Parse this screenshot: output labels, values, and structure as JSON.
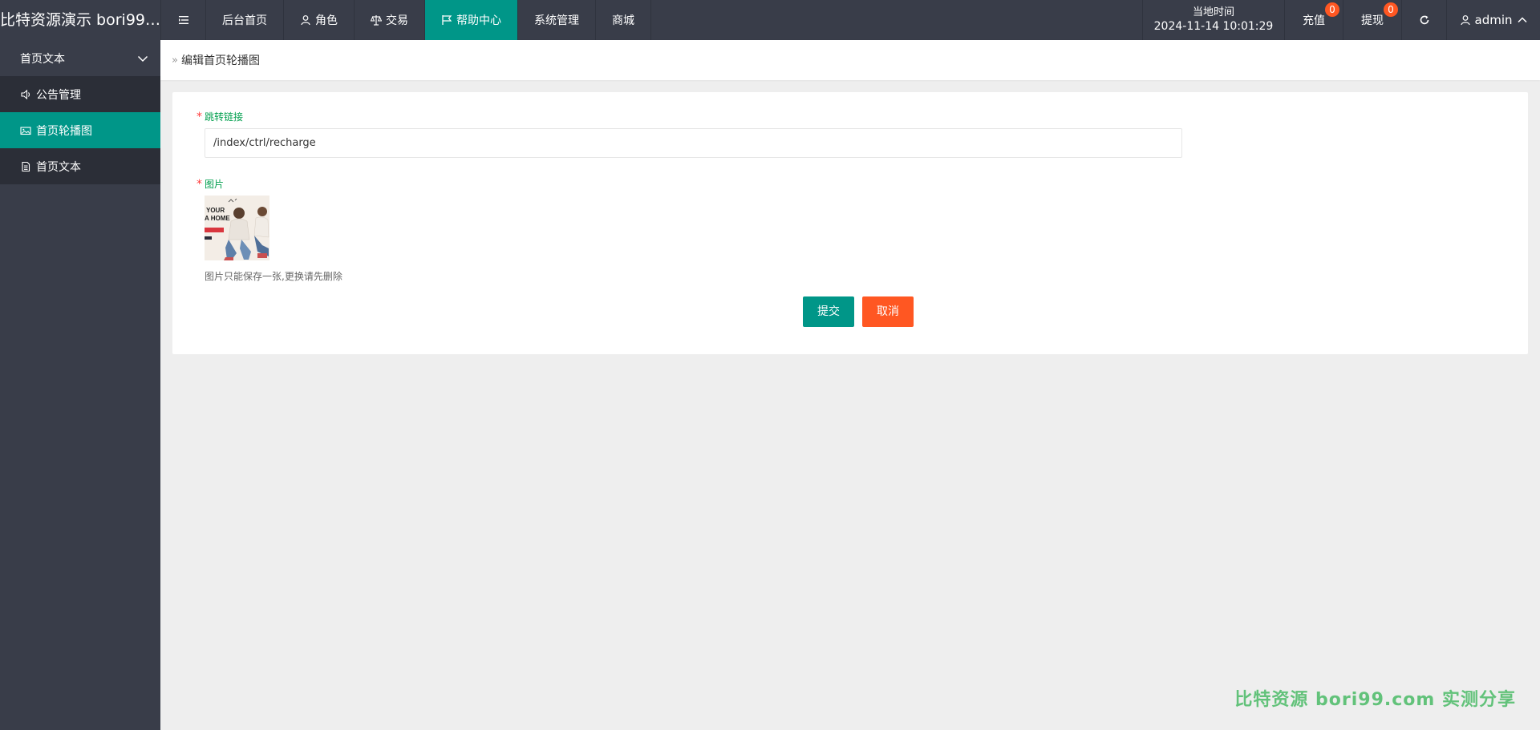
{
  "header": {
    "logo": "比特资源演示 bori99.c...",
    "nav": [
      {
        "label": "后台首页",
        "icon": "none"
      },
      {
        "label": "角色",
        "icon": "user-icon"
      },
      {
        "label": "交易",
        "icon": "scale-icon"
      },
      {
        "label": "帮助中心",
        "icon": "flag-icon",
        "active": true
      },
      {
        "label": "系统管理",
        "icon": "none"
      },
      {
        "label": "商城",
        "icon": "none"
      }
    ],
    "time_label": "当地时间",
    "time_value": "2024-11-14 10:01:29",
    "recharge": {
      "label": "充值",
      "badge": "0"
    },
    "withdraw": {
      "label": "提现",
      "badge": "0"
    },
    "user": "admin",
    "accent_color": "#009688",
    "badge_color": "#ff5722"
  },
  "sidebar": {
    "group": "首页文本",
    "items": [
      {
        "label": "公告管理",
        "icon": "speaker-icon"
      },
      {
        "label": "首页轮播图",
        "icon": "image-icon",
        "active": true
      },
      {
        "label": "首页文本",
        "icon": "document-icon"
      }
    ]
  },
  "breadcrumb": {
    "separator": "»",
    "current": "编辑首页轮播图"
  },
  "form": {
    "link_label": "跳转链接",
    "link_value": "/index/ctrl/recharge",
    "image_label": "图片",
    "image_hint": "图片只能保存一张,更换请先删除",
    "required_mark": "*",
    "thumb_text_1": "YOUR",
    "thumb_text_2": "A HOME",
    "submit": "提交",
    "cancel": "取消"
  },
  "watermark": "比特资源 bori99.com 实测分享"
}
